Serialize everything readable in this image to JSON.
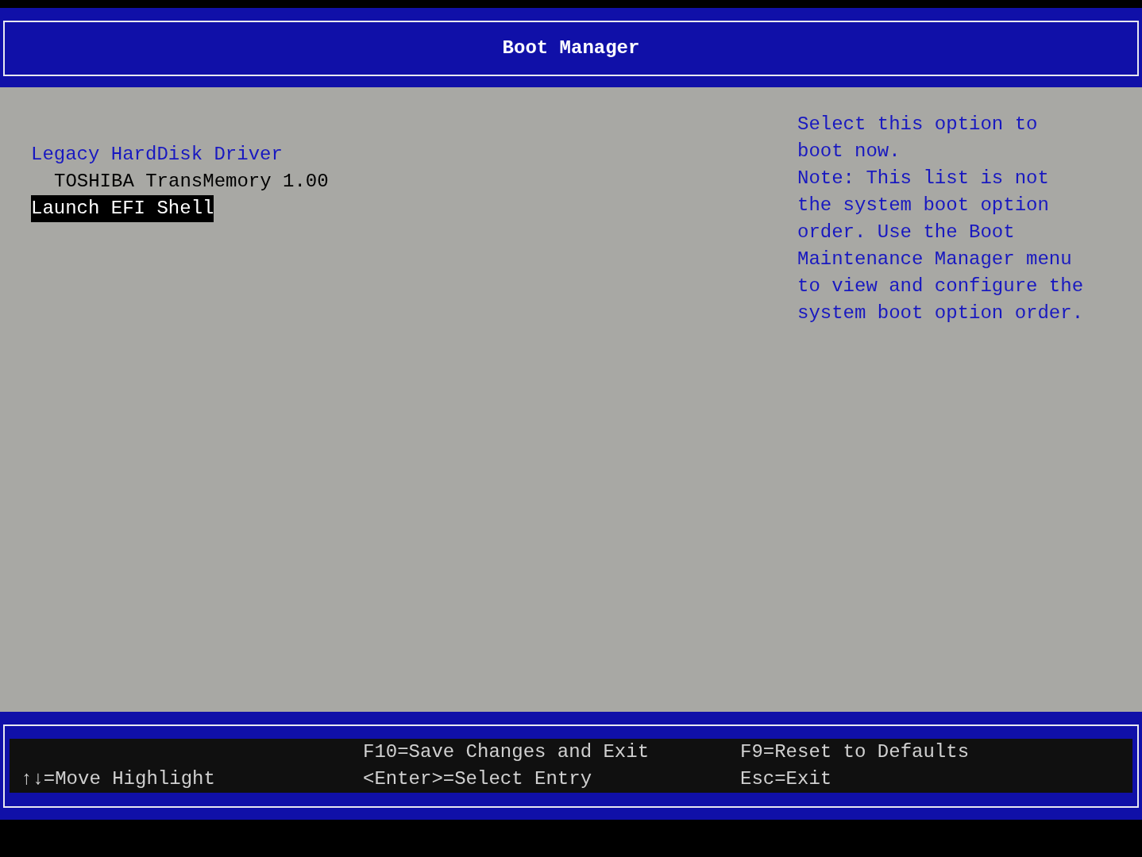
{
  "header": {
    "title": "Boot Manager"
  },
  "boot_menu": [
    {
      "kind": "group",
      "label": "Legacy HardDisk Driver",
      "selected": false
    },
    {
      "kind": "entry",
      "label": "TOSHIBA TransMemory 1.00",
      "selected": false
    },
    {
      "kind": "entry",
      "label": "Launch EFI Shell",
      "selected": true
    }
  ],
  "help_text": [
    "Select this option to boot now.",
    "Note: This list is not the system boot option order. Use the Boot Maintenance Manager menu to view and configure the system boot option order."
  ],
  "key_hints": [
    {
      "line_2": "↑↓=Move Highlight"
    },
    {
      "line_1": "F10=Save Changes and Exit",
      "line_2": "<Enter>=Select Entry"
    },
    {
      "line_1": "F9=Reset to Defaults",
      "line_2": "Esc=Exit"
    }
  ]
}
